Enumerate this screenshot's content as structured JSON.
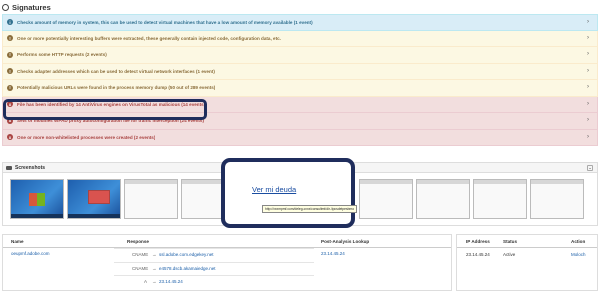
{
  "signatures": {
    "title": "Signatures",
    "items": [
      {
        "level": "info",
        "text": "Checks amount of memory in system, this can be used to detect virtual machines that have a low amount of memory available (1 event)"
      },
      {
        "level": "warn",
        "text": "One or more potentially interesting buffers were extracted, these generally contain injected code, configuration data, etc."
      },
      {
        "level": "warn",
        "text": "Performs some HTTP requests (2 events)"
      },
      {
        "level": "warn",
        "text": "Checks adapter addresses which can be used to detect virtual network interfaces (1 event)"
      },
      {
        "level": "warn",
        "text": "Potentially malicious URLs were found in the process memory dump (50 out of 289 events)"
      },
      {
        "level": "danger",
        "text": "File has been identified by 14 AntiVirus engines on VirusTotal as malicious (14 events)"
      },
      {
        "level": "danger",
        "text": "Sets or modifies WPAD proxy autoconfiguration file for traffic interception (24 events)"
      },
      {
        "level": "danger",
        "text": "One or more non-whitelisted processes were created (2 events)"
      }
    ]
  },
  "screenshots": {
    "title": "Screenshots",
    "popup_link": "Ver mi deuda",
    "popup_tooltip": "http://xxxmpmf.com/deleg-cxxx/consultmt/dir-/ipcsdetpesbmo"
  },
  "network": {
    "headers": {
      "name": "Name",
      "response": "Response",
      "lookup": "Post-Analysis Lookup"
    },
    "name": "oeupmf.adobe.com",
    "records": [
      {
        "type": "CNAME",
        "arrow": "→",
        "value": "ssl.adobe.com.edgekey.net"
      },
      {
        "type": "CNAME",
        "arrow": "→",
        "value": "e4578.dscb.akamaiedge.net"
      },
      {
        "type": "A",
        "arrow": "→",
        "value": "23.14.45.24"
      }
    ],
    "lookup": "23.14.45.24"
  },
  "ip_table": {
    "headers": {
      "ip": "IP Address",
      "status": "Status",
      "action": "Action"
    },
    "ip": "23.14.45.24",
    "status": "Active",
    "action": "Moloch"
  },
  "colors": {
    "highlight": "#1f2d5c",
    "info": "#d9edf7",
    "warn": "#fcf8e3",
    "danger": "#f2dede"
  }
}
